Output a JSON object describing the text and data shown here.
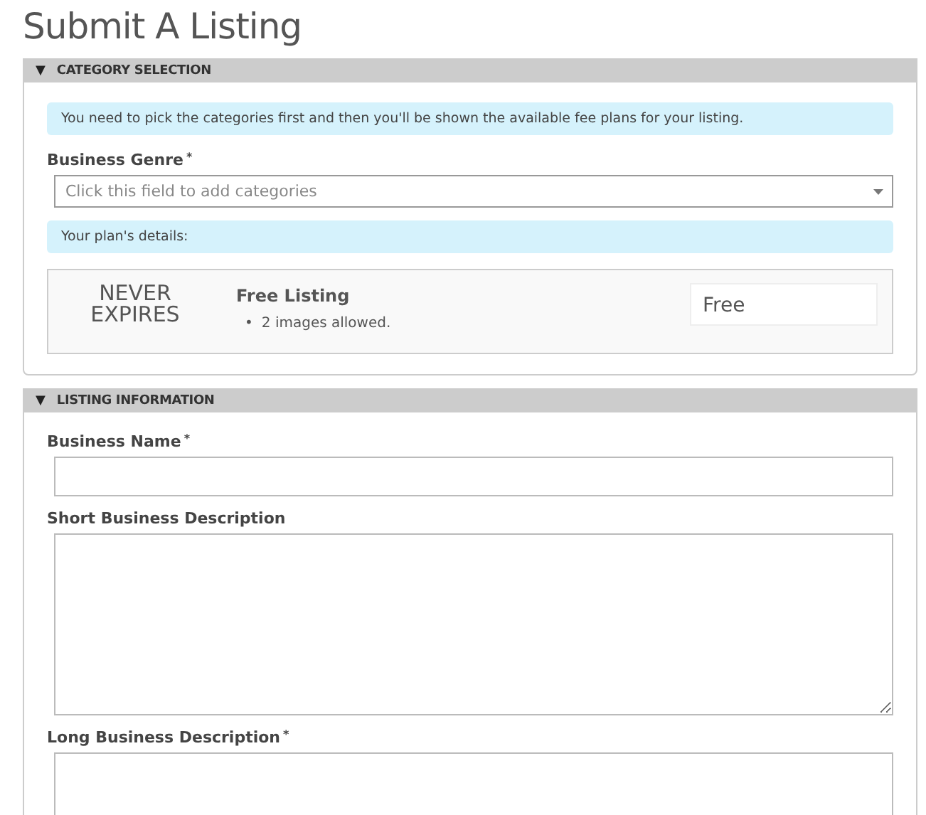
{
  "page": {
    "title": "Submit A Listing"
  },
  "sections": [
    {
      "toggle": "▼",
      "title": "CATEGORY SELECTION",
      "expanded": true,
      "items": [
        {
          "kind": "notice",
          "text": "You need to pick the categories first and then you'll be shown the available fee plans for your listing."
        },
        {
          "kind": "select",
          "label": "Business Genre",
          "required_mark": "*",
          "placeholder": "Click this field to add categories"
        },
        {
          "kind": "notice",
          "text": "Your plan's details:"
        },
        {
          "kind": "plan",
          "duration": "NEVER EXPIRES",
          "name": "Free Listing",
          "features": [
            {
              "bullet": "•",
              "text": "2 images allowed."
            }
          ],
          "price": "Free"
        }
      ]
    },
    {
      "toggle": "▼",
      "title": "LISTING INFORMATION",
      "expanded": true,
      "items": [
        {
          "kind": "input",
          "label": "Business Name",
          "required_mark": "*"
        },
        {
          "kind": "textarea",
          "label": "Short Business Description"
        },
        {
          "kind": "textarea",
          "label": "Long Business Description",
          "required_mark": "*"
        }
      ]
    }
  ]
}
